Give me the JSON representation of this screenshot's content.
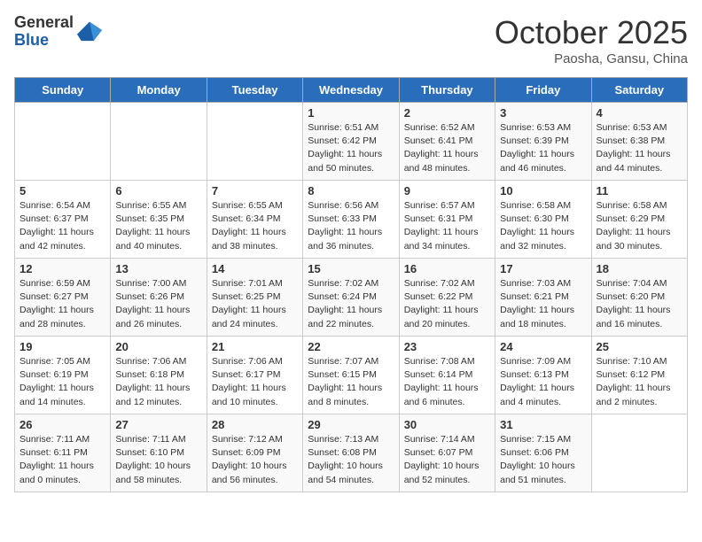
{
  "logo": {
    "general": "General",
    "blue": "Blue"
  },
  "header": {
    "month": "October 2025",
    "location": "Paosha, Gansu, China"
  },
  "days_of_week": [
    "Sunday",
    "Monday",
    "Tuesday",
    "Wednesday",
    "Thursday",
    "Friday",
    "Saturday"
  ],
  "weeks": [
    [
      {
        "day": "",
        "info": ""
      },
      {
        "day": "",
        "info": ""
      },
      {
        "day": "",
        "info": ""
      },
      {
        "day": "1",
        "info": "Sunrise: 6:51 AM\nSunset: 6:42 PM\nDaylight: 11 hours\nand 50 minutes."
      },
      {
        "day": "2",
        "info": "Sunrise: 6:52 AM\nSunset: 6:41 PM\nDaylight: 11 hours\nand 48 minutes."
      },
      {
        "day": "3",
        "info": "Sunrise: 6:53 AM\nSunset: 6:39 PM\nDaylight: 11 hours\nand 46 minutes."
      },
      {
        "day": "4",
        "info": "Sunrise: 6:53 AM\nSunset: 6:38 PM\nDaylight: 11 hours\nand 44 minutes."
      }
    ],
    [
      {
        "day": "5",
        "info": "Sunrise: 6:54 AM\nSunset: 6:37 PM\nDaylight: 11 hours\nand 42 minutes."
      },
      {
        "day": "6",
        "info": "Sunrise: 6:55 AM\nSunset: 6:35 PM\nDaylight: 11 hours\nand 40 minutes."
      },
      {
        "day": "7",
        "info": "Sunrise: 6:55 AM\nSunset: 6:34 PM\nDaylight: 11 hours\nand 38 minutes."
      },
      {
        "day": "8",
        "info": "Sunrise: 6:56 AM\nSunset: 6:33 PM\nDaylight: 11 hours\nand 36 minutes."
      },
      {
        "day": "9",
        "info": "Sunrise: 6:57 AM\nSunset: 6:31 PM\nDaylight: 11 hours\nand 34 minutes."
      },
      {
        "day": "10",
        "info": "Sunrise: 6:58 AM\nSunset: 6:30 PM\nDaylight: 11 hours\nand 32 minutes."
      },
      {
        "day": "11",
        "info": "Sunrise: 6:58 AM\nSunset: 6:29 PM\nDaylight: 11 hours\nand 30 minutes."
      }
    ],
    [
      {
        "day": "12",
        "info": "Sunrise: 6:59 AM\nSunset: 6:27 PM\nDaylight: 11 hours\nand 28 minutes."
      },
      {
        "day": "13",
        "info": "Sunrise: 7:00 AM\nSunset: 6:26 PM\nDaylight: 11 hours\nand 26 minutes."
      },
      {
        "day": "14",
        "info": "Sunrise: 7:01 AM\nSunset: 6:25 PM\nDaylight: 11 hours\nand 24 minutes."
      },
      {
        "day": "15",
        "info": "Sunrise: 7:02 AM\nSunset: 6:24 PM\nDaylight: 11 hours\nand 22 minutes."
      },
      {
        "day": "16",
        "info": "Sunrise: 7:02 AM\nSunset: 6:22 PM\nDaylight: 11 hours\nand 20 minutes."
      },
      {
        "day": "17",
        "info": "Sunrise: 7:03 AM\nSunset: 6:21 PM\nDaylight: 11 hours\nand 18 minutes."
      },
      {
        "day": "18",
        "info": "Sunrise: 7:04 AM\nSunset: 6:20 PM\nDaylight: 11 hours\nand 16 minutes."
      }
    ],
    [
      {
        "day": "19",
        "info": "Sunrise: 7:05 AM\nSunset: 6:19 PM\nDaylight: 11 hours\nand 14 minutes."
      },
      {
        "day": "20",
        "info": "Sunrise: 7:06 AM\nSunset: 6:18 PM\nDaylight: 11 hours\nand 12 minutes."
      },
      {
        "day": "21",
        "info": "Sunrise: 7:06 AM\nSunset: 6:17 PM\nDaylight: 11 hours\nand 10 minutes."
      },
      {
        "day": "22",
        "info": "Sunrise: 7:07 AM\nSunset: 6:15 PM\nDaylight: 11 hours\nand 8 minutes."
      },
      {
        "day": "23",
        "info": "Sunrise: 7:08 AM\nSunset: 6:14 PM\nDaylight: 11 hours\nand 6 minutes."
      },
      {
        "day": "24",
        "info": "Sunrise: 7:09 AM\nSunset: 6:13 PM\nDaylight: 11 hours\nand 4 minutes."
      },
      {
        "day": "25",
        "info": "Sunrise: 7:10 AM\nSunset: 6:12 PM\nDaylight: 11 hours\nand 2 minutes."
      }
    ],
    [
      {
        "day": "26",
        "info": "Sunrise: 7:11 AM\nSunset: 6:11 PM\nDaylight: 11 hours\nand 0 minutes."
      },
      {
        "day": "27",
        "info": "Sunrise: 7:11 AM\nSunset: 6:10 PM\nDaylight: 10 hours\nand 58 minutes."
      },
      {
        "day": "28",
        "info": "Sunrise: 7:12 AM\nSunset: 6:09 PM\nDaylight: 10 hours\nand 56 minutes."
      },
      {
        "day": "29",
        "info": "Sunrise: 7:13 AM\nSunset: 6:08 PM\nDaylight: 10 hours\nand 54 minutes."
      },
      {
        "day": "30",
        "info": "Sunrise: 7:14 AM\nSunset: 6:07 PM\nDaylight: 10 hours\nand 52 minutes."
      },
      {
        "day": "31",
        "info": "Sunrise: 7:15 AM\nSunset: 6:06 PM\nDaylight: 10 hours\nand 51 minutes."
      },
      {
        "day": "",
        "info": ""
      }
    ]
  ]
}
